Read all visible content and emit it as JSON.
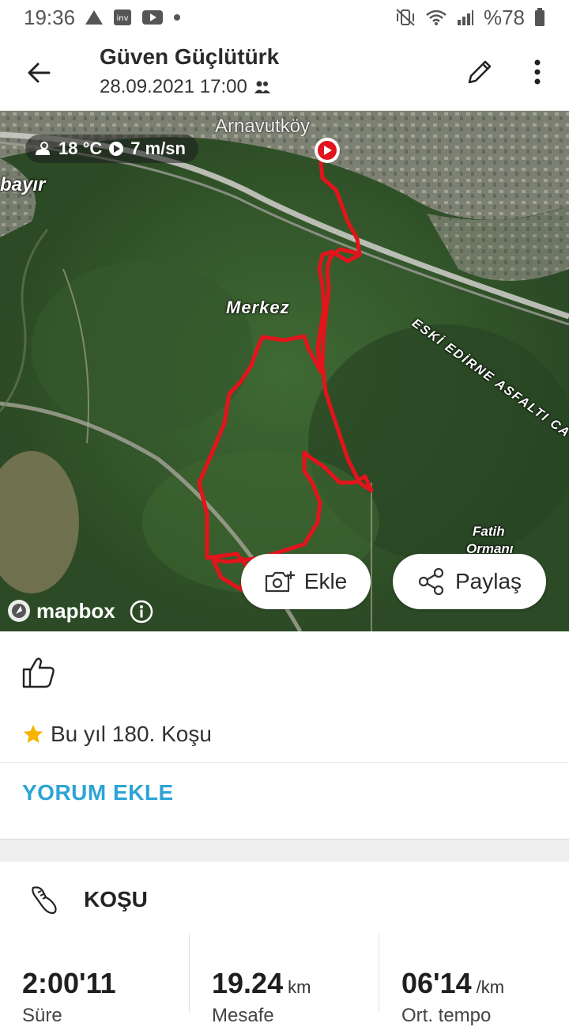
{
  "status_bar": {
    "time": "19:36",
    "battery": "%78",
    "icons": [
      "navigation-icon",
      "inv-app-icon",
      "youtube-icon",
      "dot-icon",
      "mute-vibrate-icon",
      "wifi-icon",
      "signal-icon",
      "battery-icon"
    ]
  },
  "header": {
    "user_name": "Güven Güçlütürk",
    "datetime": "28.09.2021 17:00"
  },
  "map": {
    "weather": {
      "temperature": "18 °C",
      "wind": "7 m/sn"
    },
    "labels": {
      "arnavutkoy": "Arnavutköy",
      "bayir": "bayır",
      "merkez": "Merkez",
      "road": "ESKİ EDİRNE ASFALTI CA",
      "fatih": "Fatih",
      "ormani": "Ormanı"
    },
    "add_photo_label": "Ekle",
    "share_label": "Paylaş",
    "attribution": "mapbox",
    "route_color": "#e3141b"
  },
  "achievement": "Bu yıl 180. Koşu",
  "comment_label": "YORUM EKLE",
  "activity": {
    "type": "KOŞU",
    "stats": [
      {
        "value": "2:00'11",
        "unit": "",
        "label": "Süre"
      },
      {
        "value": "19.24",
        "unit": "km",
        "label": "Mesafe"
      },
      {
        "value": "06'14",
        "unit": "/km",
        "label": "Ort. tempo"
      }
    ]
  },
  "colors": {
    "accent": "#2ea3d6",
    "route": "#e3141b"
  }
}
